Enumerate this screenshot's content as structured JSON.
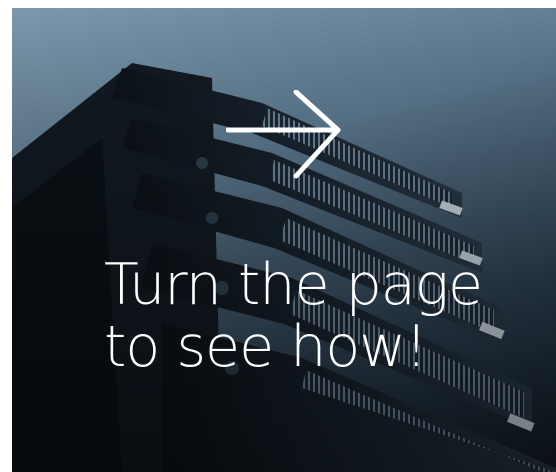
{
  "banner": {
    "headline_line1": "Turn the page",
    "headline_line2": "to see how!",
    "arrow_icon": "arrow-right-icon",
    "colors": {
      "text": "#ffffff",
      "background_light": "#7d98ad",
      "background_dark": "#101a24"
    }
  }
}
